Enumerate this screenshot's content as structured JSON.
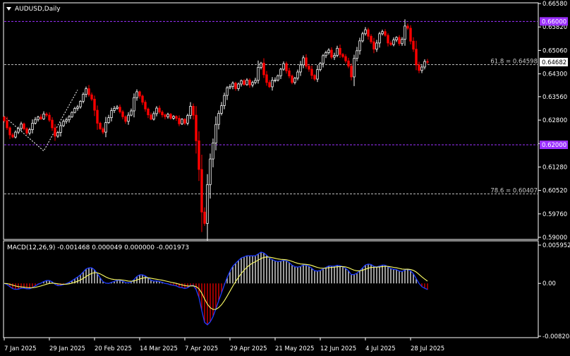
{
  "chart_data": [
    {
      "type": "candlestick",
      "title": "AUDUSD,Daily",
      "y_ticks": [
        "0.66580",
        "0.65820",
        "0.65060",
        "0.64300",
        "0.63560",
        "0.62800",
        "0.62040",
        "0.61280",
        "0.60520",
        "0.59760",
        "0.59000"
      ],
      "ylim": [
        0.59,
        0.6658
      ],
      "x_ticks": [
        "7 Jan 2025",
        "29 Jan 2025",
        "20 Feb 2025",
        "14 Mar 2025",
        "7 Apr 2025",
        "29 Apr 2025",
        "21 May 2025",
        "12 Jun 2025",
        "4 Jul 2025",
        "28 Jul 2025"
      ],
      "horizontal_levels": [
        {
          "value": 0.66,
          "label": "0.66000",
          "color": "#9b30ff"
        },
        {
          "value": 0.62,
          "label": "0.62000",
          "color": "#9b30ff"
        }
      ],
      "fibonacci_levels": [
        {
          "value": 0.64598,
          "label": "61.8 = 0.64598"
        },
        {
          "value": 0.60407,
          "label": "78.6 = 0.60407"
        }
      ],
      "current_price": "0.64682",
      "bull_color": "#ffffff",
      "bear_color": "#ff0000",
      "close_series": [
        0.6278,
        0.6255,
        0.6232,
        0.6225,
        0.6241,
        0.6253,
        0.6268,
        0.6252,
        0.6238,
        0.6249,
        0.627,
        0.6282,
        0.629,
        0.6284,
        0.63,
        0.6296,
        0.628,
        0.6255,
        0.6228,
        0.624,
        0.6262,
        0.6276,
        0.6281,
        0.6291,
        0.6305,
        0.6318,
        0.6323,
        0.6341,
        0.6364,
        0.6382,
        0.6362,
        0.6348,
        0.6312,
        0.627,
        0.6252,
        0.6241,
        0.6272,
        0.6288,
        0.6311,
        0.6318,
        0.6322,
        0.6307,
        0.6291,
        0.6276,
        0.6296,
        0.631,
        0.6353,
        0.6372,
        0.6358,
        0.6338,
        0.6316,
        0.6297,
        0.6283,
        0.6301,
        0.6319,
        0.6306,
        0.6297,
        0.6291,
        0.6299,
        0.6286,
        0.6292,
        0.6286,
        0.6268,
        0.6283,
        0.627,
        0.6295,
        0.6325,
        0.6296,
        0.6213,
        0.612,
        0.5982,
        0.5945,
        0.6071,
        0.6154,
        0.6206,
        0.6266,
        0.6302,
        0.6327,
        0.636,
        0.6385,
        0.6389,
        0.64,
        0.6382,
        0.6397,
        0.6408,
        0.6395,
        0.641,
        0.6394,
        0.6402,
        0.6409,
        0.6451,
        0.6465,
        0.6427,
        0.6402,
        0.6388,
        0.6409,
        0.641,
        0.6424,
        0.6445,
        0.6463,
        0.644,
        0.6423,
        0.6402,
        0.6416,
        0.6436,
        0.6459,
        0.6482,
        0.6455,
        0.6445,
        0.6425,
        0.6413,
        0.6444,
        0.6464,
        0.6489,
        0.6499,
        0.6507,
        0.6484,
        0.649,
        0.6513,
        0.6493,
        0.6486,
        0.6472,
        0.6455,
        0.642,
        0.648,
        0.6505,
        0.6537,
        0.656,
        0.6573,
        0.6552,
        0.6534,
        0.651,
        0.653,
        0.656,
        0.6567,
        0.6555,
        0.653,
        0.6525,
        0.654,
        0.6548,
        0.6528,
        0.6542,
        0.6585,
        0.6578,
        0.6536,
        0.651,
        0.6459,
        0.6441,
        0.6452,
        0.647,
        0.6468
      ],
      "macd": {
        "label": "MACD(12,26,9) -0.001468 0.000049 0.000000 -0.001973",
        "y_ticks": [
          "0.005952",
          "0.00",
          "-0.008204"
        ],
        "ylim": [
          -0.008204,
          0.005952
        ]
      }
    }
  ]
}
